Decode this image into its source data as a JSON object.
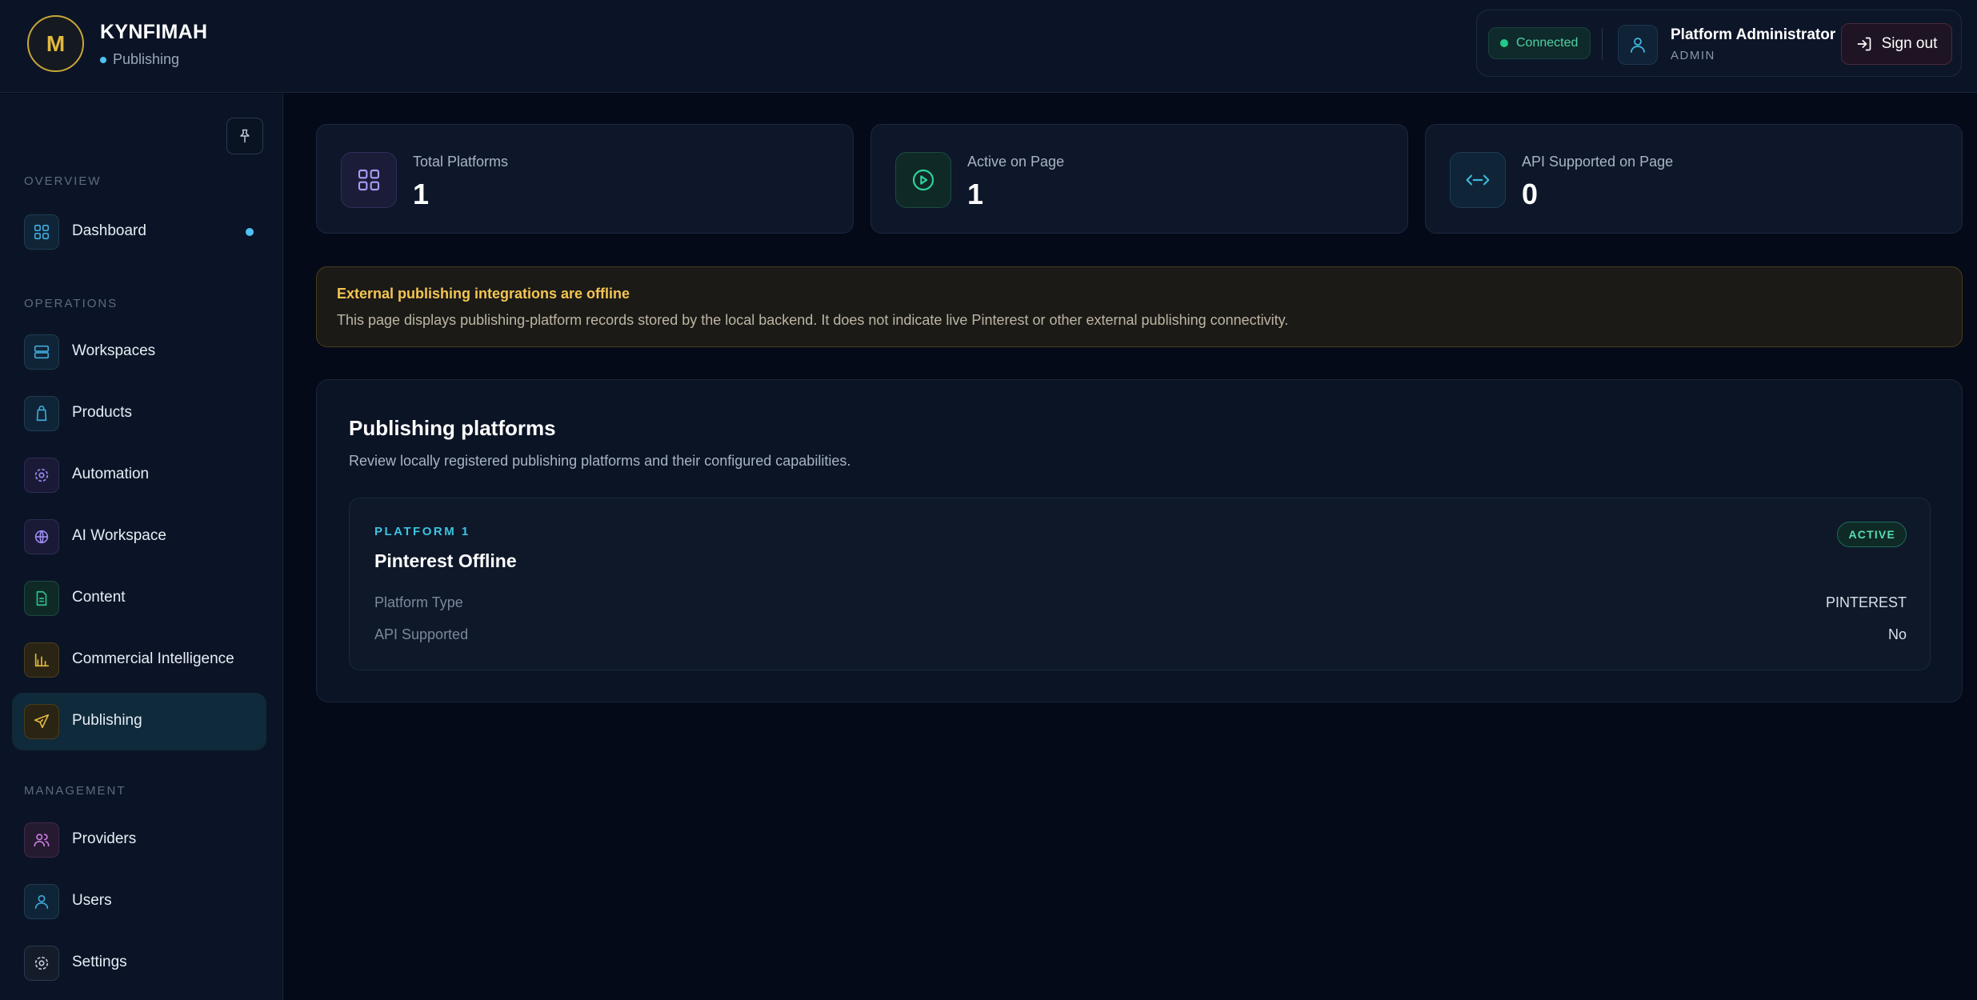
{
  "brand": {
    "initial": "M",
    "name": "KYNFIMAH",
    "subtitle": "Publishing"
  },
  "header": {
    "connection_status": "Connected",
    "user_name": "Platform Administrator",
    "user_role": "ADMIN",
    "signout_label": "Sign out"
  },
  "sidebar": {
    "sections": {
      "overview": "OVERVIEW",
      "operations": "OPERATIONS",
      "management": "MANAGEMENT"
    },
    "items": [
      {
        "label": "Dashboard",
        "icon": "grid-icon",
        "color": "#3fa9d8"
      },
      {
        "label": "Workspaces",
        "icon": "server-icon",
        "color": "#3fa9d8"
      },
      {
        "label": "Products",
        "icon": "shopping-bag-icon",
        "color": "#3fa9d8"
      },
      {
        "label": "Automation",
        "icon": "gear-icon",
        "color": "#9b8cf0"
      },
      {
        "label": "AI Workspace",
        "icon": "globe-icon",
        "color": "#9b8cf0"
      },
      {
        "label": "Content",
        "icon": "document-icon",
        "color": "#2fbf8f"
      },
      {
        "label": "Commercial Intelligence",
        "icon": "chart-icon",
        "color": "#e3b93f"
      },
      {
        "label": "Publishing",
        "icon": "send-icon",
        "color": "#e3b93f"
      },
      {
        "label": "Providers",
        "icon": "users-icon",
        "color": "#c67de0"
      },
      {
        "label": "Users",
        "icon": "user-icon",
        "color": "#3fa9d8"
      },
      {
        "label": "Settings",
        "icon": "gear-icon",
        "color": "#c2cad6"
      }
    ]
  },
  "stats": [
    {
      "label": "Total Platforms",
      "value": "1",
      "icon": "grid-icon",
      "color": "#a99cf5"
    },
    {
      "label": "Active on Page",
      "value": "1",
      "icon": "play-circle-icon",
      "color": "#2fd3a0"
    },
    {
      "label": "API Supported on Page",
      "value": "0",
      "icon": "code-arrows-icon",
      "color": "#3fb8e0"
    }
  ],
  "alert": {
    "title": "External publishing integrations are offline",
    "text": "This page displays publishing-platform records stored by the local backend. It does not indicate live Pinterest or other external publishing connectivity."
  },
  "panel": {
    "title": "Publishing platforms",
    "description": "Review locally registered publishing platforms and their configured capabilities.",
    "platforms": [
      {
        "kicker": "PLATFORM 1",
        "name": "Pinterest Offline",
        "status": "ACTIVE",
        "rows": [
          {
            "label": "Platform Type",
            "value": "PINTEREST"
          },
          {
            "label": "API Supported",
            "value": "No"
          }
        ]
      }
    ]
  }
}
